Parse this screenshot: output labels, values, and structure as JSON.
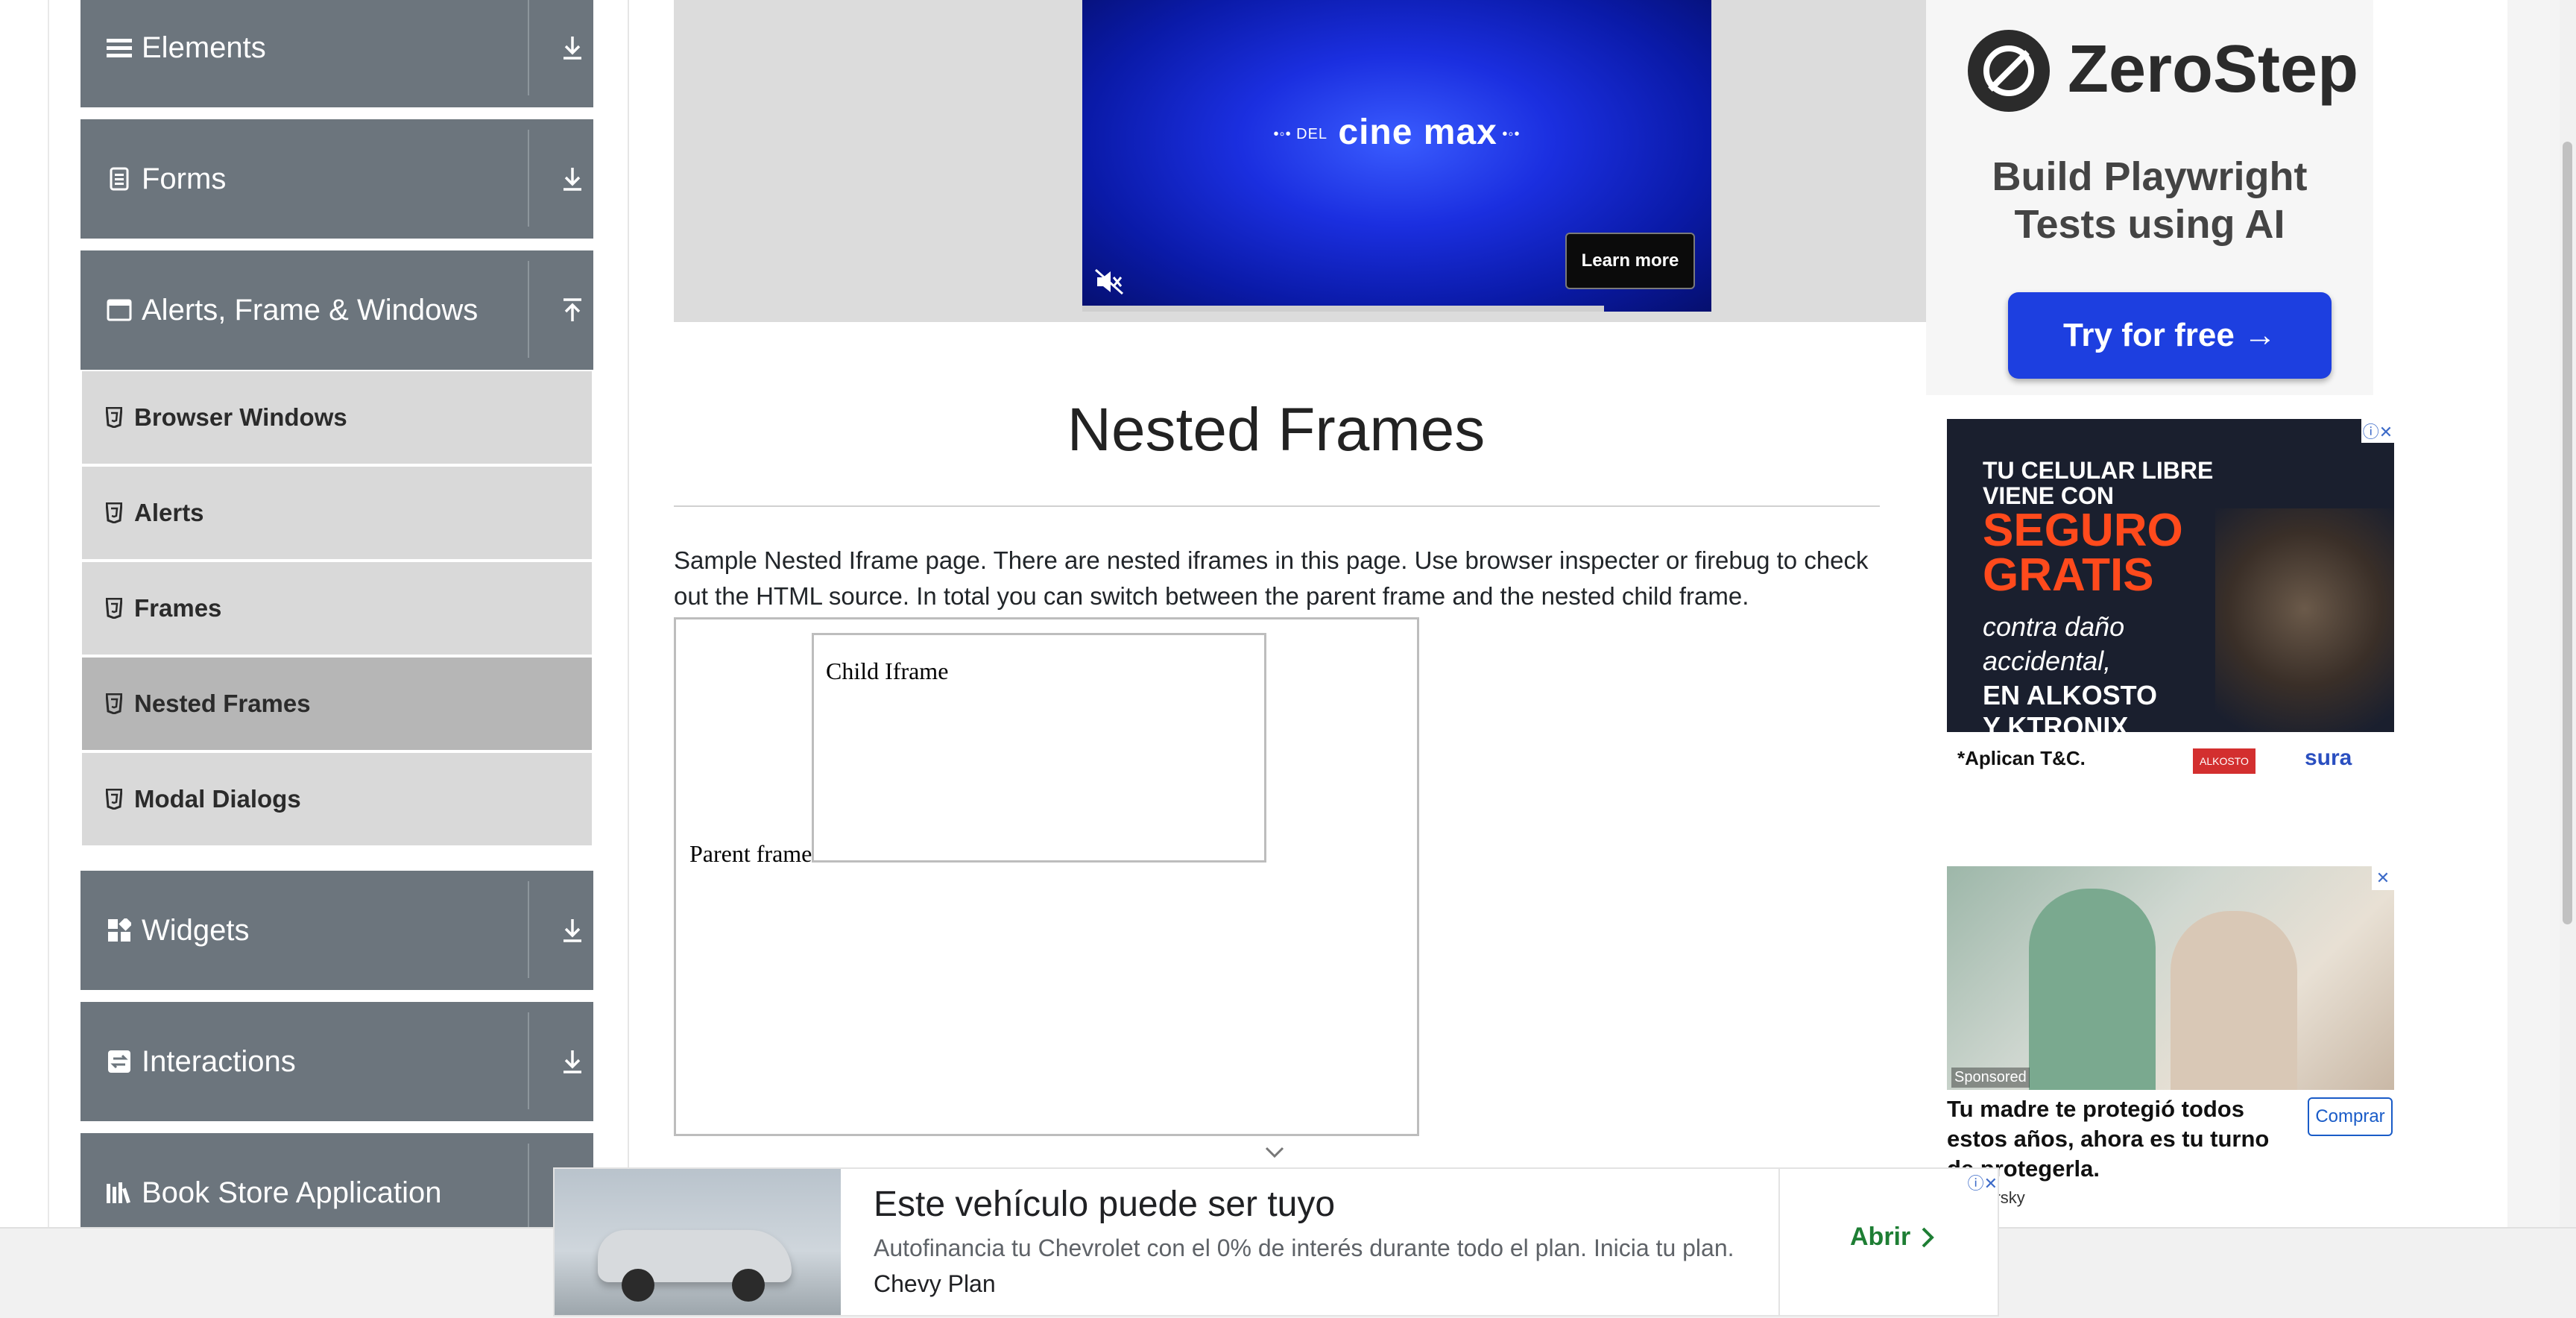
{
  "sidebar": {
    "groups": [
      {
        "label": "Elements",
        "icon": "hamburger-icon",
        "arrow": "download-icon"
      },
      {
        "label": "Forms",
        "icon": "document-icon",
        "arrow": "download-icon"
      },
      {
        "label": "Alerts, Frame & Windows",
        "icon": "window-icon",
        "arrow": "upload-icon"
      },
      {
        "label": "Widgets",
        "icon": "grid-icon",
        "arrow": "download-icon"
      },
      {
        "label": "Interactions",
        "icon": "swap-icon",
        "arrow": "download-icon"
      },
      {
        "label": "Book Store Application",
        "icon": "books-icon",
        "arrow": "download-icon"
      }
    ],
    "items": [
      {
        "label": "Browser Windows",
        "active": false
      },
      {
        "label": "Alerts",
        "active": false
      },
      {
        "label": "Frames",
        "active": false
      },
      {
        "label": "Nested Frames",
        "active": true
      },
      {
        "label": "Modal Dialogs",
        "active": false
      }
    ]
  },
  "video_ad": {
    "logo_prefix": "DEL",
    "logo_text": "cine max",
    "learn_more": "Learn more"
  },
  "main": {
    "title": "Nested Frames",
    "description": "Sample Nested Iframe page. There are nested iframes in this page. Use browser inspecter or firebug to check out the HTML source. In total you can switch between the parent frame and the nested child frame.",
    "parent_label": "Parent frame",
    "child_label": "Child Iframe"
  },
  "ads": {
    "zerostep": {
      "name": "ZeroStep",
      "tagline_1": "Build Playwright",
      "tagline_2": "Tests using AI",
      "button": "Try for free →"
    },
    "alkosto": {
      "line1": "TU CELULAR LIBRE",
      "line2": "VIENE CON",
      "seguro": "SEGURO",
      "gratis": "GRATIS",
      "sub1": "contra daño",
      "sub2": "accidental,",
      "sub3": "EN ALKOSTO",
      "sub4": "Y KTRONIX",
      "footnote": "*Aplican T&C.",
      "brand2": "sura"
    },
    "mother": {
      "sponsored": "Sponsored",
      "headline": "Tu madre te protegió todos estos años, ahora es tu turno de protegerla.",
      "button": "Comprar",
      "brand": "persky"
    },
    "bottom": {
      "headline": "Este vehículo puede ser tuyo",
      "subtext": "Autofinancia tu Chevrolet con el 0% de interés durante todo el plan. Inicia tu plan.",
      "brand": "Chevy Plan",
      "cta": "Abrir"
    }
  },
  "colors": {
    "sidebar_group": "#6c757d",
    "sidebar_item": "#d9d9d9",
    "sidebar_item_active": "#b6b6b6",
    "zerostep_button": "#1d3fe0",
    "cta_green": "#1e7e34"
  }
}
